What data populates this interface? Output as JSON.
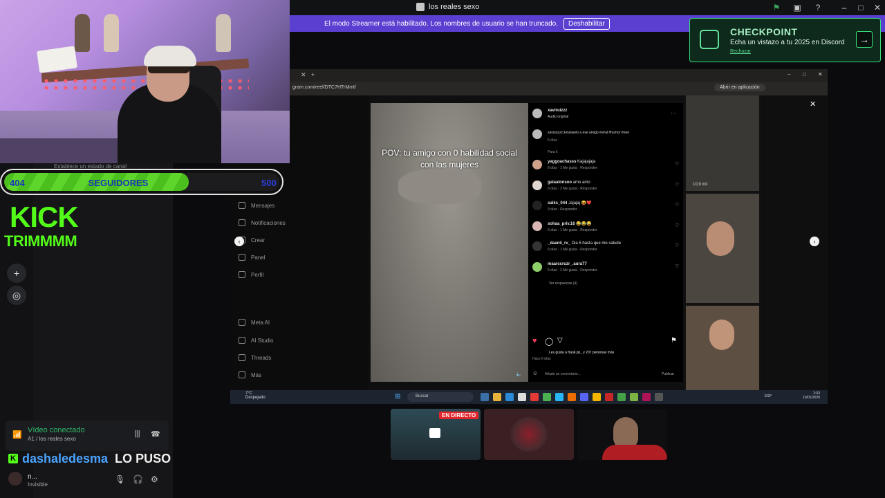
{
  "window": {
    "title": "los reales sexo"
  },
  "banner": {
    "text": "El modo Streamer está habilitado. Los nombres de usuario se han truncado.",
    "button": "Deshabilitar"
  },
  "checkpoint": {
    "title": "CHECKPOINT",
    "subtitle": "Echa un vistazo a tu 2025 en Discord",
    "dismiss": "Rechazar"
  },
  "followers": {
    "current": "404",
    "label": "SEGUIDORES",
    "goal": "500",
    "progress": 0.808
  },
  "kick_logo": {
    "line1": "KICK",
    "line2": "TRIMMMM"
  },
  "voice": {
    "status": "Vídeo conectado",
    "channel": "A1 / los reales sexo"
  },
  "user": {
    "name": "n...",
    "status": "Invisible"
  },
  "chat_overlay": {
    "username": "dashaledesma",
    "message": "LO PUSO"
  },
  "status_hint": "Establece un estado de canal",
  "browser": {
    "url": "gram.com/reel/DTC7HTrMmt/",
    "open_app": "Abrir en aplicación"
  },
  "ig_nav": [
    {
      "label": "Mensajes",
      "icon": "send-icon"
    },
    {
      "label": "Notificaciones",
      "icon": "heart-icon"
    },
    {
      "label": "Crear",
      "icon": "plus-icon"
    },
    {
      "label": "Panel",
      "icon": "chart-icon"
    },
    {
      "label": "Perfil",
      "icon": "profile-icon"
    },
    {
      "label": "Meta AI",
      "icon": "meta-ai-icon"
    },
    {
      "label": "AI Studio",
      "icon": "ai-studio-icon"
    },
    {
      "label": "Threads",
      "icon": "threads-icon"
    },
    {
      "label": "Más",
      "icon": "menu-icon"
    }
  ],
  "reel": {
    "caption": "POV: tu amigo con 0 habilidad social con las mujeres",
    "author": "xaviruizzz",
    "audio": "Audio original",
    "description": "xaviruizzz Enviaselo a ese amigo #viral #humor #reel",
    "description_age": "6 días",
    "for_you": "Para ti",
    "likes_text": "Les gusta a frank.pk_ y 207 personas más",
    "posted": "Hace 6 días",
    "comment_placeholder": "Añade un comentario...",
    "publish": "Publicar",
    "view_replies": "Ver respuestas (4)"
  },
  "comments": [
    {
      "user": "yaggoachasss",
      "text": "Kajajajaja",
      "meta": "6 días · 1 Me gusta · Responder"
    },
    {
      "user": "galaalonsoo",
      "text": "amo amo",
      "meta": "6 días · 2 Me gusta · Responder"
    },
    {
      "user": "saiks_044",
      "text": "Jajajaj 😝❤️",
      "meta": "3 días · Responder"
    },
    {
      "user": "sohaa_priv.16",
      "text": "😂😂😂",
      "meta": "6 días · 1 Me gusta · Responder"
    },
    {
      "user": "_daanii_rv_",
      "text": "Dia 5 hasta que me salude",
      "meta": "6 días · 1 Me gusta · Responder"
    },
    {
      "user": "maarccruzr_.aura77",
      "text": "",
      "meta": "5 días · 2 Me gusta · Responder"
    }
  ],
  "suggestions": [
    {
      "label": "10,9 mil"
    },
    {
      "label": ""
    },
    {
      "label": ""
    }
  ],
  "taskbar": {
    "weather_temp": "7°C",
    "weather_desc": "Despejado",
    "search": "Buscar",
    "lang": "ESP",
    "time": "2:03",
    "date": "10/01/2026"
  },
  "tiles": {
    "live_badge": "EN DIRECTO"
  },
  "colors": {
    "kick_green": "#53fc18",
    "discord_blurple": "#5b3fd0",
    "follow_fill": "#4bbf1e"
  }
}
